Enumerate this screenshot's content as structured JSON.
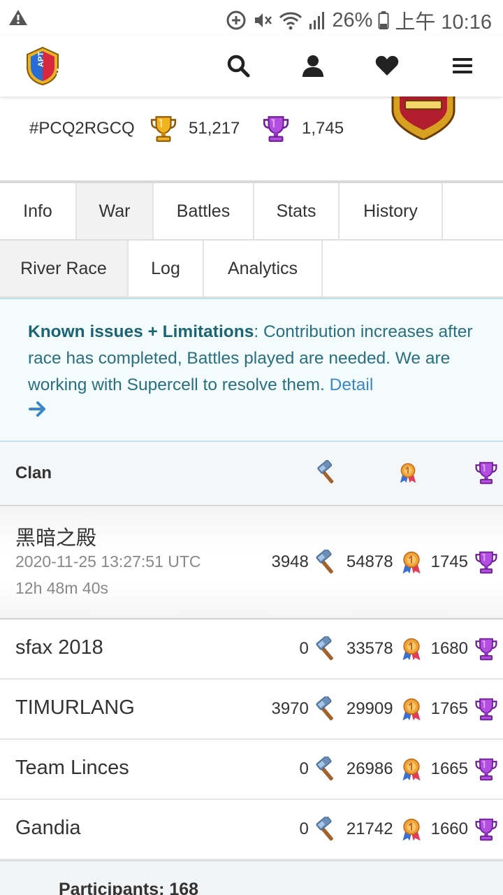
{
  "status_bar": {
    "battery": "26%",
    "time": "上午 10:16",
    "icons": [
      "warning-icon",
      "data-saver-icon",
      "mute-icon",
      "wifi-icon",
      "signal-icon",
      "battery-icon"
    ]
  },
  "navbar": {
    "logo_text": "APT\nVb1",
    "icons": [
      "search-icon",
      "user-icon",
      "heart-icon",
      "menu-icon"
    ]
  },
  "clan": {
    "tag": "#PCQ2RGCQ",
    "trophies": "51,217",
    "war_trophies": "1,745"
  },
  "tabs": [
    "Info",
    "War",
    "Battles",
    "Stats",
    "History"
  ],
  "active_tab": "War",
  "subtabs": [
    "River Race",
    "Log",
    "Analytics"
  ],
  "active_subtab": "River Race",
  "notice": {
    "bold": "Known issues + Limitations",
    "text": ": Contribution increases after race has completed, Battles played are needed. We are working with Supercell to resolve them. ",
    "link": "Detail"
  },
  "table": {
    "header": "Clan",
    "rows": [
      {
        "name": "黑暗之殿",
        "date": "2020-11-25 13:27:51 UTC",
        "timer": "12h 48m 40s",
        "repair": "3948",
        "fame": "54878",
        "trophies": "1745"
      },
      {
        "name": "sfax 2018",
        "repair": "0",
        "fame": "33578",
        "trophies": "1680"
      },
      {
        "name": "TIMURLANG",
        "repair": "3970",
        "fame": "29909",
        "trophies": "1765"
      },
      {
        "name": "Team Linces",
        "repair": "0",
        "fame": "26986",
        "trophies": "1665"
      },
      {
        "name": "Gandia",
        "repair": "0",
        "fame": "21742",
        "trophies": "1660"
      }
    ]
  },
  "participants": "Participants: 168",
  "colors": {
    "notice_bg": "#f3fbfd",
    "notice_text": "#2a6f7d",
    "link": "#3a86c8",
    "trophy_purple": "#a23fd6",
    "trophy_gold": "#e9a21c"
  }
}
